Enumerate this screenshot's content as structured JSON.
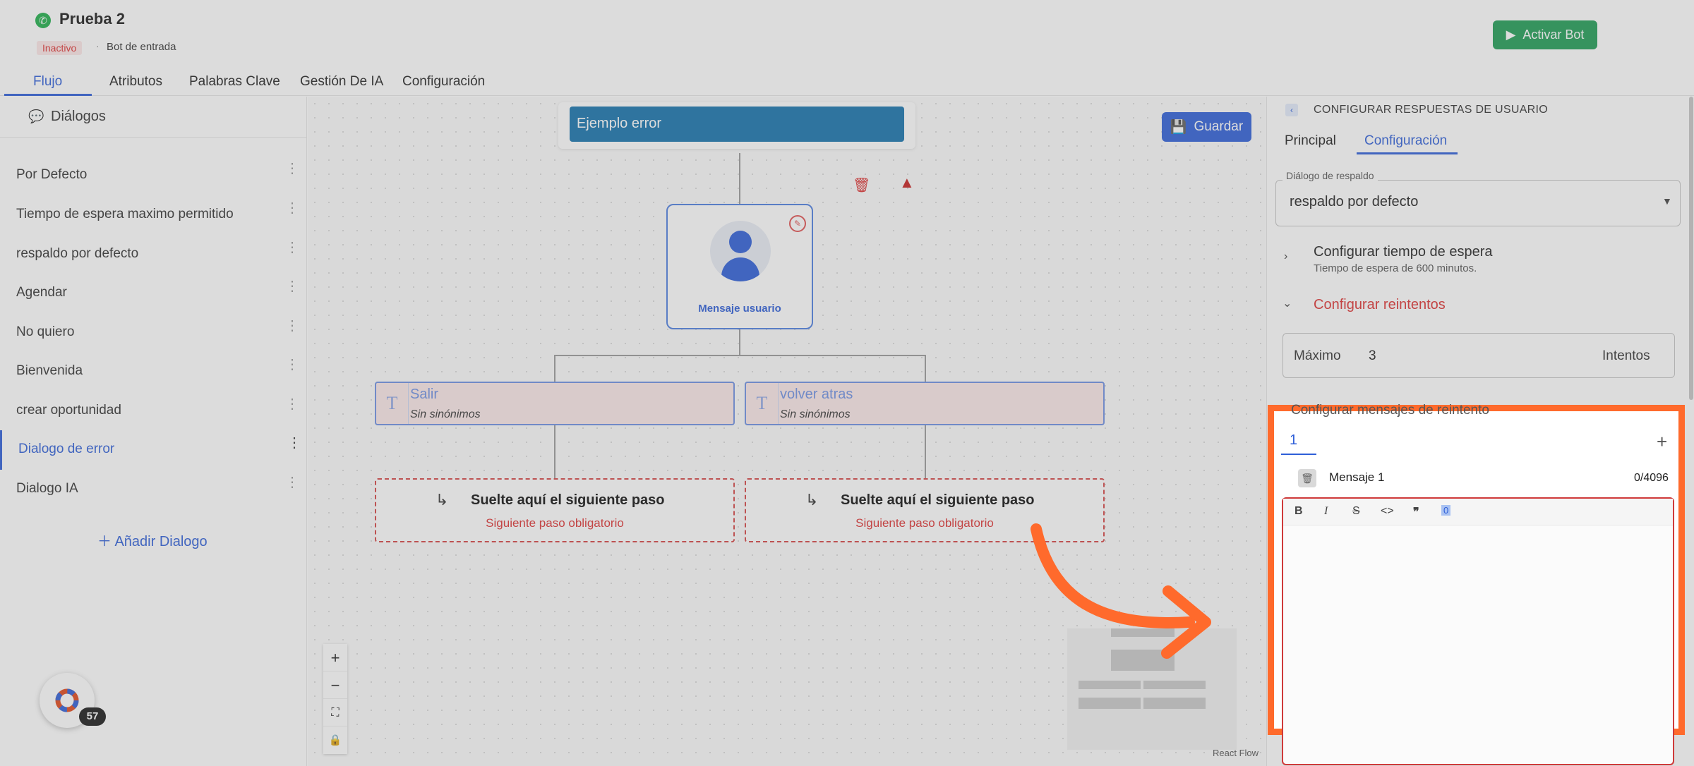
{
  "header": {
    "bot_name": "Prueba 2",
    "status": "Inactivo",
    "separator": "·",
    "bot_type": "Bot de entrada",
    "activate_label": "Activar Bot"
  },
  "tabs": [
    {
      "label": "Flujo"
    },
    {
      "label": "Atributos"
    },
    {
      "label": "Palabras Clave"
    },
    {
      "label": "Gestión De IA"
    },
    {
      "label": "Configuración"
    }
  ],
  "sidebar": {
    "header": "Diálogos",
    "items": [
      {
        "label": "Por Defecto"
      },
      {
        "label": "Tiempo de espera maximo permitido"
      },
      {
        "label": "respaldo por defecto"
      },
      {
        "label": "Agendar"
      },
      {
        "label": "No quiero"
      },
      {
        "label": "Bienvenida"
      },
      {
        "label": "crear oportunidad"
      },
      {
        "label": "Dialogo de error"
      },
      {
        "label": "Dialogo IA"
      }
    ],
    "add_label": "Añadir Dialogo",
    "notification_count": "57"
  },
  "canvas": {
    "node_title": "Ejemplo error",
    "save_label": "Guardar",
    "user_node_label": "Mensaje usuario",
    "options": [
      {
        "name": "Salir",
        "synonyms": "Sin sinónimos"
      },
      {
        "name": "volver atras",
        "synonyms": "Sin sinónimos"
      }
    ],
    "drop_title": "Suelte aquí el siguiente paso",
    "drop_subtitle": "Siguiente paso obligatorio",
    "attribution": "React Flow"
  },
  "panel": {
    "title": "CONFIGURAR RESPUESTAS DE USUARIO",
    "tabs": [
      {
        "label": "Principal"
      },
      {
        "label": "Configuración"
      }
    ],
    "fallback_label": "Diálogo de respaldo",
    "fallback_value": "respaldo por defecto",
    "timeout_title": "Configurar tiempo de espera",
    "timeout_sub": "Tiempo de espera de 600 minutos.",
    "retries_title": "Configurar reintentos",
    "max_label": "Máximo",
    "max_value": "3",
    "max_unit": "Intentos",
    "retry_msgs_title": "Configurar mensajes de reintento",
    "retry_tab": "1",
    "message_label": "Mensaje 1",
    "char_count": "0/4096"
  },
  "colors": {
    "accent": "#2f5fd8",
    "success": "#1f9d55",
    "danger": "#d33333",
    "highlight": "#ff6a2c"
  }
}
